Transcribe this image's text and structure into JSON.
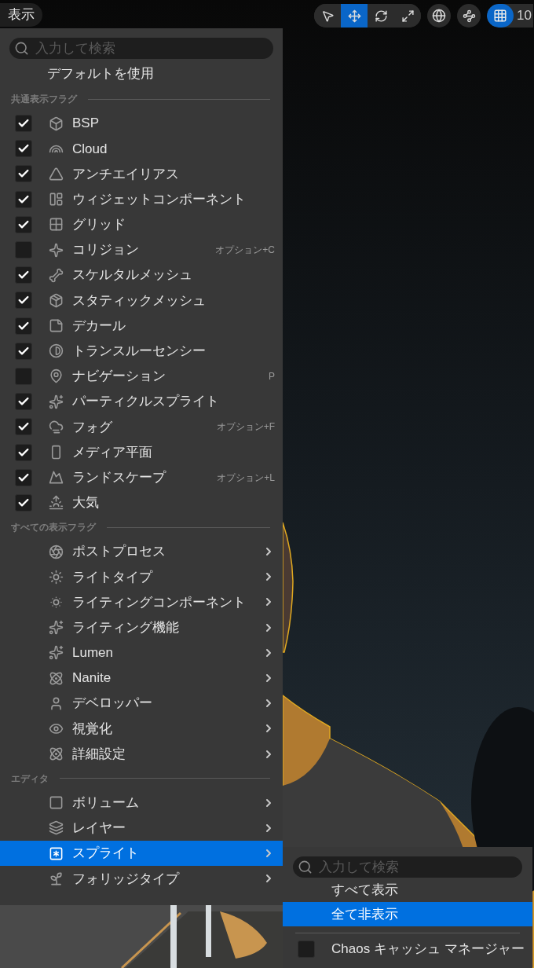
{
  "view_button": "表示",
  "toolbar": {
    "transform_tools": [
      {
        "selected": false
      },
      {
        "selected": true
      },
      {
        "selected": false
      },
      {
        "selected": false
      }
    ],
    "grid_snap": {
      "on": true,
      "value": "10"
    }
  },
  "menu": {
    "search": {
      "placeholder": "入力して検索"
    },
    "default_item": "デフォルトを使用",
    "sections": [
      {
        "title": "共通表示フラグ",
        "items": [
          {
            "kind": "checkbox",
            "label": "BSP",
            "checked": true,
            "selected": false
          },
          {
            "kind": "checkbox",
            "label": "Cloud",
            "checked": true,
            "selected": false
          },
          {
            "kind": "checkbox",
            "label": "アンチエイリアス",
            "checked": true,
            "selected": false
          },
          {
            "kind": "checkbox",
            "label": "ウィジェットコンポーネント",
            "checked": true,
            "selected": false
          },
          {
            "kind": "checkbox",
            "label": "グリッド",
            "checked": true,
            "selected": false
          },
          {
            "kind": "checkbox",
            "label": "コリジョン",
            "checked": false,
            "selected": false,
            "shortcut": "オプション+C"
          },
          {
            "kind": "checkbox",
            "label": "スケルタルメッシュ",
            "checked": true,
            "selected": false
          },
          {
            "kind": "checkbox",
            "label": "スタティックメッシュ",
            "checked": true,
            "selected": false
          },
          {
            "kind": "checkbox",
            "label": "デカール",
            "checked": true,
            "selected": false
          },
          {
            "kind": "checkbox",
            "label": "トランスルーセンシー",
            "checked": true,
            "selected": false
          },
          {
            "kind": "checkbox",
            "label": "ナビゲーション",
            "checked": false,
            "selected": false,
            "shortcut": "P"
          },
          {
            "kind": "checkbox",
            "label": "パーティクルスプライト",
            "checked": true,
            "selected": false
          },
          {
            "kind": "checkbox",
            "label": "フォグ",
            "checked": true,
            "selected": false,
            "shortcut": "オプション+F"
          },
          {
            "kind": "checkbox",
            "label": "メディア平面",
            "checked": true,
            "selected": false
          },
          {
            "kind": "checkbox",
            "label": "ランドスケープ",
            "checked": true,
            "selected": false,
            "shortcut": "オプション+L"
          },
          {
            "kind": "checkbox",
            "label": "大気",
            "checked": true,
            "selected": false
          }
        ]
      },
      {
        "title": "すべての表示フラグ",
        "items": [
          {
            "kind": "submenu",
            "label": "ポストプロセス",
            "selected": false
          },
          {
            "kind": "submenu",
            "label": "ライトタイプ",
            "selected": false
          },
          {
            "kind": "submenu",
            "label": "ライティングコンポーネント",
            "selected": false
          },
          {
            "kind": "submenu",
            "label": "ライティング機能",
            "selected": false
          },
          {
            "kind": "submenu",
            "label": "Lumen",
            "selected": false
          },
          {
            "kind": "submenu",
            "label": "Nanite",
            "selected": false
          },
          {
            "kind": "submenu",
            "label": "デベロッパー",
            "selected": false
          },
          {
            "kind": "submenu",
            "label": "視覚化",
            "selected": false
          },
          {
            "kind": "submenu",
            "label": "詳細設定",
            "selected": false
          }
        ]
      },
      {
        "title": "エディタ",
        "items": [
          {
            "kind": "submenu",
            "label": "ボリューム",
            "selected": false
          },
          {
            "kind": "submenu",
            "label": "レイヤー",
            "selected": false
          },
          {
            "kind": "submenu",
            "label": "スプライト",
            "selected": true
          },
          {
            "kind": "submenu",
            "label": "フォリッジタイプ",
            "selected": false
          }
        ]
      }
    ]
  },
  "submenu": {
    "search": {
      "placeholder": "入力して検索"
    },
    "items": [
      {
        "label": "すべて表示",
        "selected": false
      },
      {
        "label": "全て非表示",
        "selected": true
      }
    ],
    "flags": [
      {
        "label": "Chaos キャッシュ マネージャー",
        "checked": false
      }
    ]
  }
}
